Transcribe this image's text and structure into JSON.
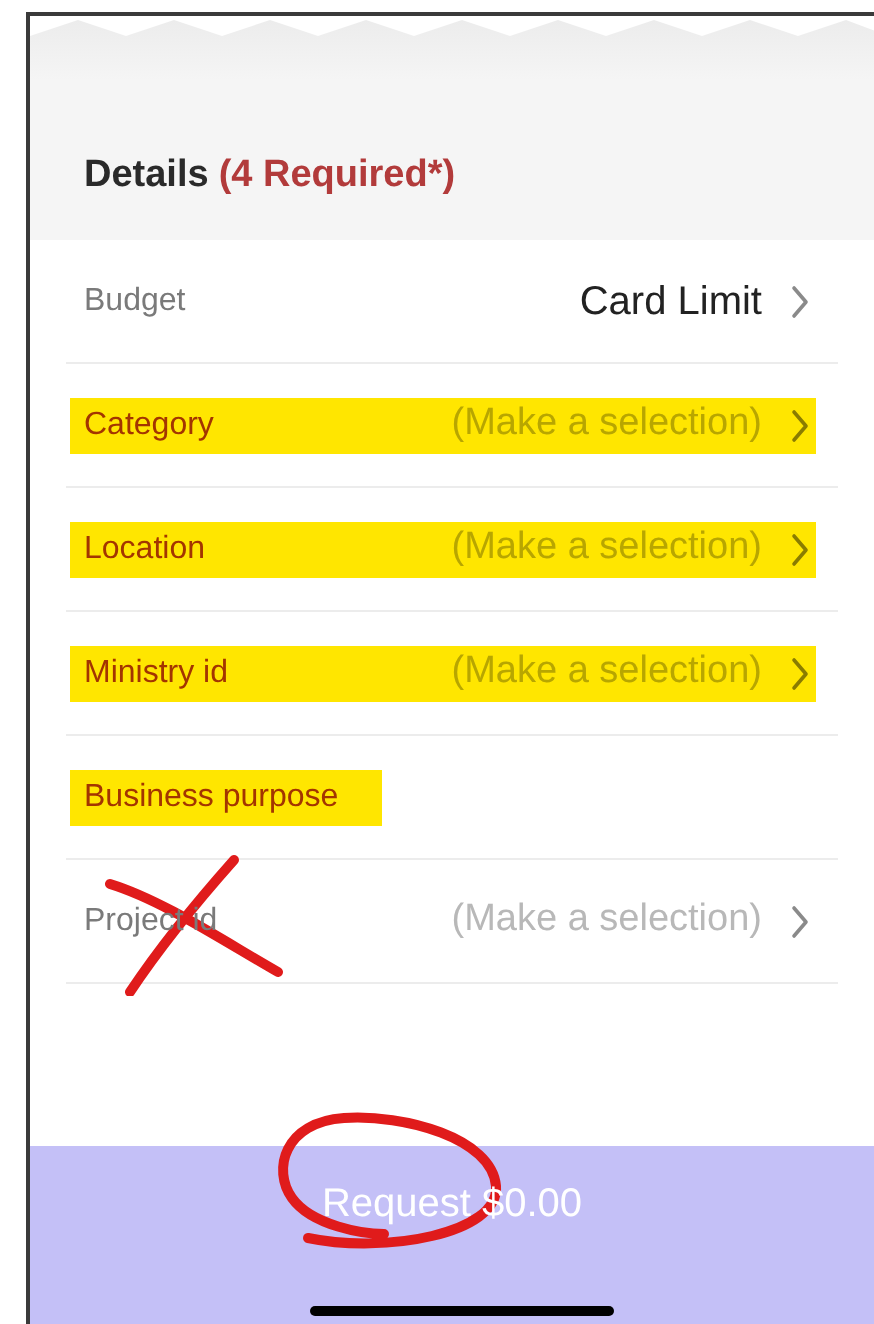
{
  "section": {
    "title": "Details",
    "required_note": "(4 Required*)"
  },
  "rows": [
    {
      "label": "Budget",
      "value": "Card Limit",
      "placeholder": false,
      "chevron": true,
      "required": false,
      "highlighted": false,
      "crossed_out": false
    },
    {
      "label": "Category",
      "value": "(Make a selection)",
      "placeholder": true,
      "chevron": true,
      "required": true,
      "highlighted": true,
      "crossed_out": false
    },
    {
      "label": "Location",
      "value": "(Make a selection)",
      "placeholder": true,
      "chevron": true,
      "required": true,
      "highlighted": true,
      "crossed_out": false
    },
    {
      "label": "Ministry id",
      "value": "(Make a selection)",
      "placeholder": true,
      "chevron": true,
      "required": true,
      "highlighted": true,
      "crossed_out": false
    },
    {
      "label": "Business purpose",
      "chevron": false,
      "required": true,
      "highlighted": true,
      "crossed_out": false
    },
    {
      "label": "Project id",
      "value": "(Make a selection)",
      "placeholder": true,
      "chevron": true,
      "required": false,
      "highlighted": false,
      "crossed_out": true
    }
  ],
  "request_button": {
    "label": "Request $0.00",
    "circled": true
  }
}
